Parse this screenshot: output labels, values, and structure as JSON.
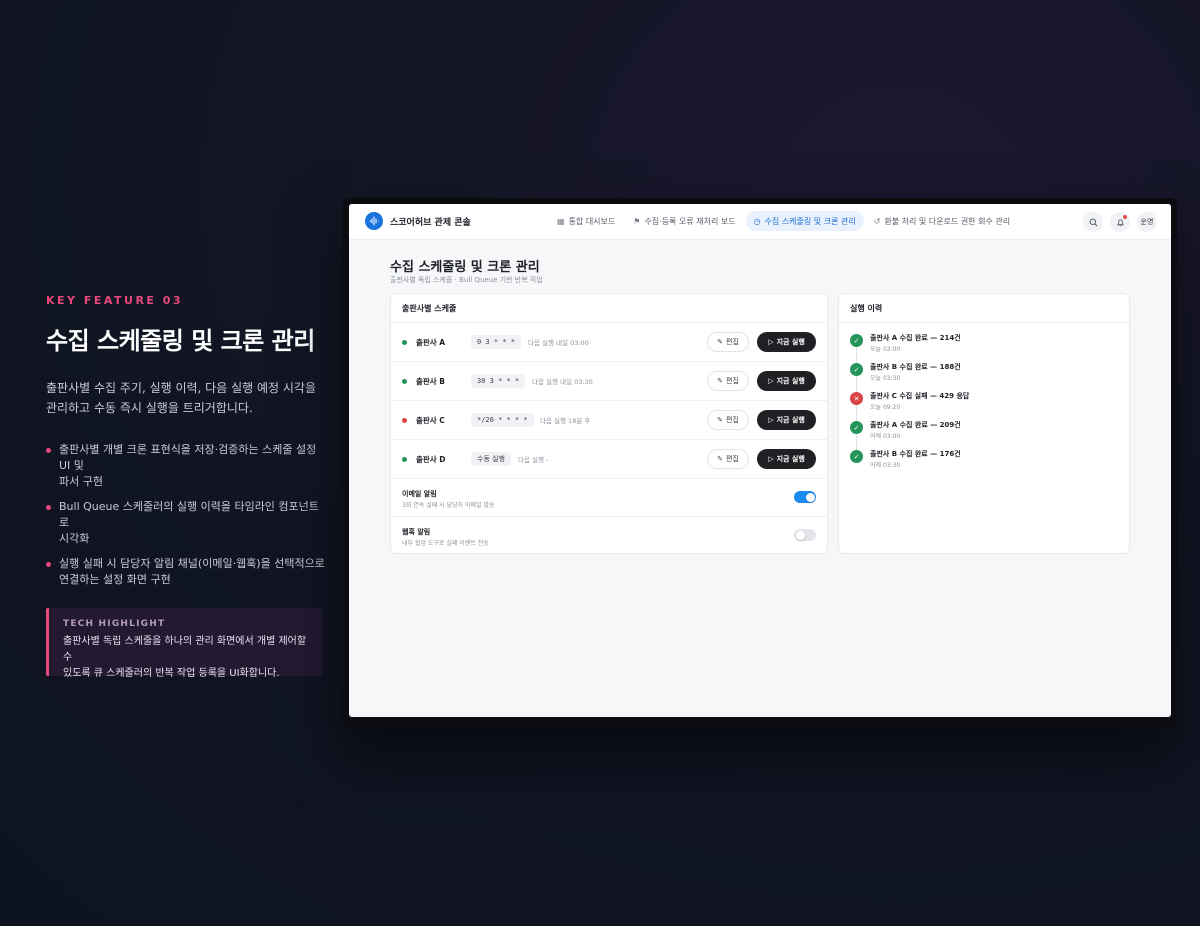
{
  "feature": {
    "eyebrow": "KEY FEATURE 03",
    "title": "수집 스케줄링 및 크론 관리",
    "description_1": "출판사별 수집 주기, 실행 이력, 다음 실행 예정 시각을",
    "description_2": "관리하고 수동 즉시 실행을 트리거합니다.",
    "bullets": [
      {
        "line1": "출판사별 개별 크론 표현식을 저장·검증하는 스케줄 설정 UI 및",
        "line2": "파서 구현"
      },
      {
        "line1": "Bull Queue 스케줄러의 실행 이력을 타임라인 컴포넌트로",
        "line2": "시각화"
      },
      {
        "line1": "실행 실패 시 담당자 알림 채널(이메일·웹훅)을 선택적으로",
        "line2": "연결하는 설정 화면 구현"
      }
    ],
    "tech_highlight": {
      "title": "TECH HIGHLIGHT",
      "line1": "출판사별 독립 스케줄을 하나의 관리 화면에서 개별 제어할 수",
      "line2": "있도록 큐 스케줄러의 반복 작업 등록을 UI화합니다."
    }
  },
  "app": {
    "brand": "스코어허브 관제 콘솔",
    "nav": [
      {
        "label": "통합 대시보드",
        "icon": "grid-icon"
      },
      {
        "label": "수집·등록 오류 재처리 보드",
        "icon": "flag-icon"
      },
      {
        "label": "수집 스케줄링 및 크론 관리",
        "icon": "clock-icon",
        "active": true
      },
      {
        "label": "환불 처리 및 다운로드 권한 회수 관리",
        "icon": "undo-icon"
      }
    ],
    "user_label": "운영",
    "page_title": "수집 스케줄링 및 크론 관리",
    "page_subtitle": "출판사별 독립 스케줄 · Bull Queue 기반 반복 작업",
    "schedule": {
      "title": "출판사별 스케줄",
      "edit_label": "편집",
      "run_label": "지금 실행",
      "rows": [
        {
          "name": "출판사 A",
          "cron": "0 3 * * *",
          "next": "다음 실행 내일 03:00",
          "status_color": "#24945b"
        },
        {
          "name": "출판사 B",
          "cron": "30 3 * * *",
          "next": "다음 실행 내일 03:30",
          "status_color": "#24945b"
        },
        {
          "name": "출판사 C",
          "cron": "*/20 * * * *",
          "next": "다음 실행 18분 후",
          "status_color": "#d94444"
        },
        {
          "name": "출판사 D",
          "cron": "수동 실행",
          "next": "다음 실행 -",
          "status_color": "#24945b"
        }
      ],
      "alerts": [
        {
          "title": "이메일 알림",
          "subtitle": "3회 연속 실패 시 담당자 이메일 발송",
          "enabled": true
        },
        {
          "title": "웹훅 알림",
          "subtitle": "내부 협업 도구로 실패 이벤트 전송",
          "enabled": false
        }
      ]
    },
    "history": {
      "title": "실행 이력",
      "items": [
        {
          "title": "출판사 A 수집 완료 — 214건",
          "time": "오늘 03:00",
          "result": "success"
        },
        {
          "title": "출판사 B 수집 완료 — 188건",
          "time": "오늘 03:30",
          "result": "success"
        },
        {
          "title": "출판사 C 수집 실패 — 429 응답",
          "time": "오늘 09:20",
          "result": "failure"
        },
        {
          "title": "출판사 A 수집 완료 — 209건",
          "time": "어제 03:00",
          "result": "success"
        },
        {
          "title": "출판사 B 수집 완료 — 176건",
          "time": "어제 03:30",
          "result": "success"
        }
      ]
    }
  },
  "colors": {
    "accent_pink": "#e8487c",
    "primary_blue": "#1a74e0",
    "success": "#24945b",
    "failure": "#d94444"
  }
}
